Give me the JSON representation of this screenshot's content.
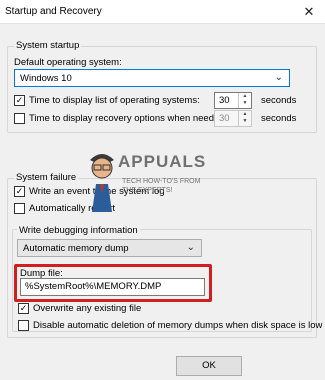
{
  "window": {
    "title": "Startup and Recovery",
    "close_glyph": "✕"
  },
  "system_startup": {
    "label": "System startup",
    "default_os_label": "Default operating system:",
    "default_os_value": "Windows 10",
    "time_list": {
      "label": "Time to display list of operating systems:",
      "checked": true,
      "value": "30",
      "unit": "seconds"
    },
    "time_recovery": {
      "label": "Time to display recovery options when needed:",
      "checked": false,
      "value": "30",
      "unit": "seconds"
    }
  },
  "system_failure": {
    "label": "System failure",
    "write_event": {
      "label": "Write an event to the system log",
      "checked": true
    },
    "auto_restart": {
      "label": "Automatically restart",
      "checked": false
    },
    "debug_info": {
      "label": "Write debugging information",
      "dump_type": "Automatic memory dump",
      "dump_file_label": "Dump file:",
      "dump_file_value": "%SystemRoot%\\MEMORY.DMP",
      "overwrite": {
        "label": "Overwrite any existing file",
        "checked": true
      },
      "disable_auto_delete": {
        "label": "Disable automatic deletion of memory dumps when disk space is low",
        "checked": false
      }
    }
  },
  "buttons": {
    "ok": "OK"
  },
  "watermark": {
    "line1": "APPUALS",
    "line2": "TECH HOW-TO'S FROM",
    "line3": "THE EXPERTS!"
  },
  "colors": {
    "highlight": "#d01f1f",
    "focus": "#0078d7"
  }
}
